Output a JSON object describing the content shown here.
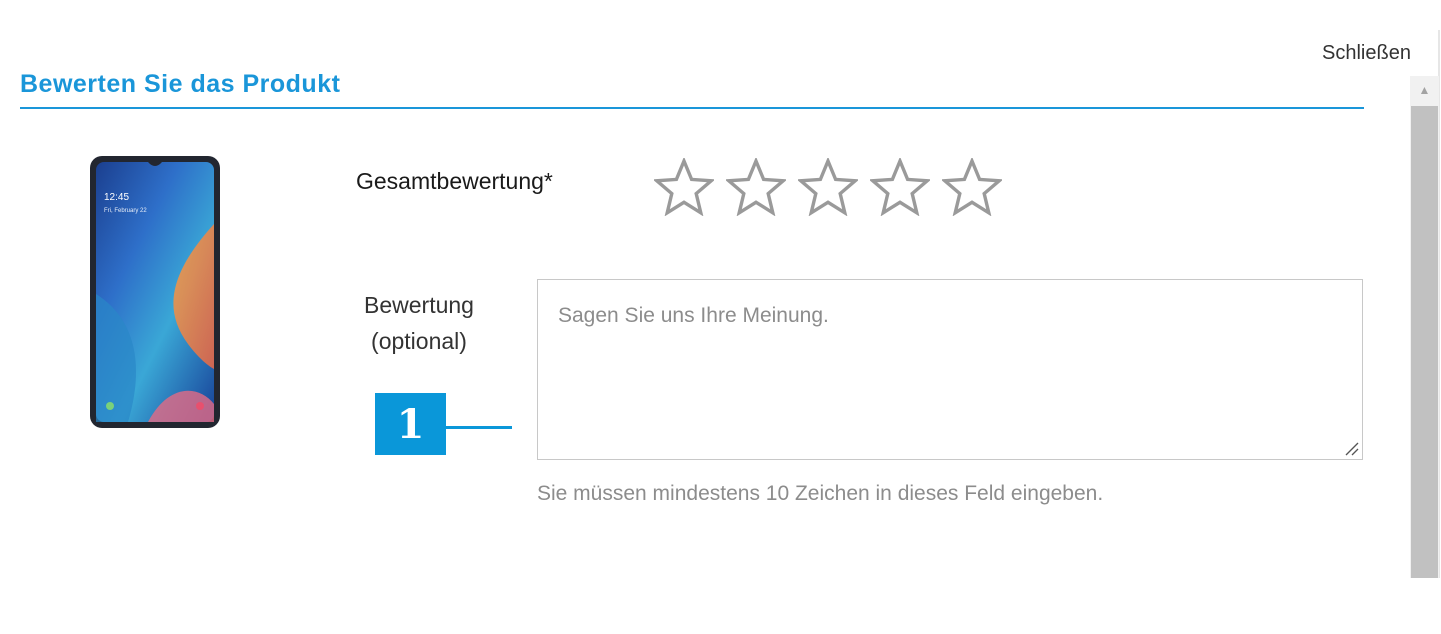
{
  "dialog": {
    "close_label": "Schließen",
    "title": "Bewerten Sie das Produkt"
  },
  "product": {
    "image_icon": "smartphone-image",
    "screen_time": "12:45",
    "screen_date": "Fri, February 22"
  },
  "rating": {
    "label": "Gesamtbewertung*",
    "max_stars": 5,
    "value": 0
  },
  "review": {
    "label_line1": "Bewertung",
    "label_line2": "(optional)",
    "placeholder": "Sagen Sie uns Ihre Meinung.",
    "value": "",
    "hint": "Sie müssen mindestens 10  Zeichen in dieses Feld eingeben."
  },
  "callout": {
    "number": "1"
  },
  "colors": {
    "accent": "#1a96d9",
    "callout": "#0a97d9",
    "star_outline": "#9a9a9a"
  }
}
